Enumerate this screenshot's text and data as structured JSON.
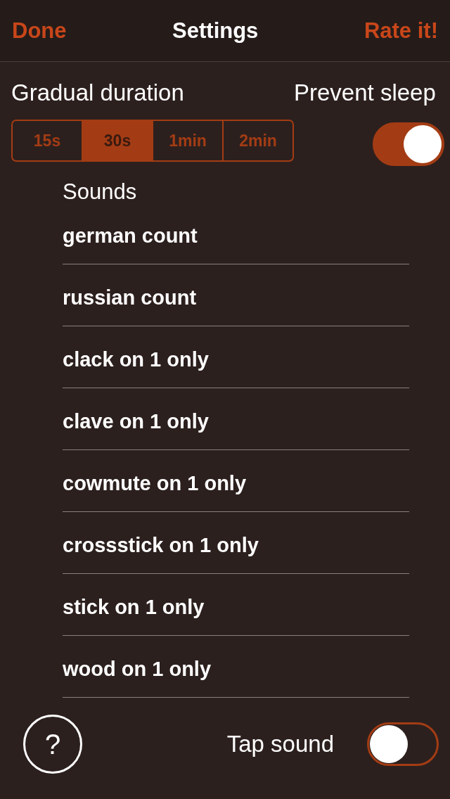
{
  "header": {
    "left_button": "Done",
    "title": "Settings",
    "right_button": "Rate it!"
  },
  "gradual_duration": {
    "label": "Gradual duration",
    "options": [
      {
        "label": "15s",
        "selected": false
      },
      {
        "label": "30s",
        "selected": true
      },
      {
        "label": "1min",
        "selected": false
      },
      {
        "label": "2min",
        "selected": false
      }
    ]
  },
  "prevent_sleep": {
    "label": "Prevent sleep",
    "on": true
  },
  "sounds": {
    "label": "Sounds",
    "items": [
      "german count",
      "russian count",
      "clack on 1 only",
      "clave on 1 only",
      "cowmute on 1 only",
      "crossstick on 1 only",
      "stick on 1 only",
      "wood on 1 only"
    ]
  },
  "help_button": "?",
  "tap_sound": {
    "label": "Tap sound",
    "on": false
  }
}
